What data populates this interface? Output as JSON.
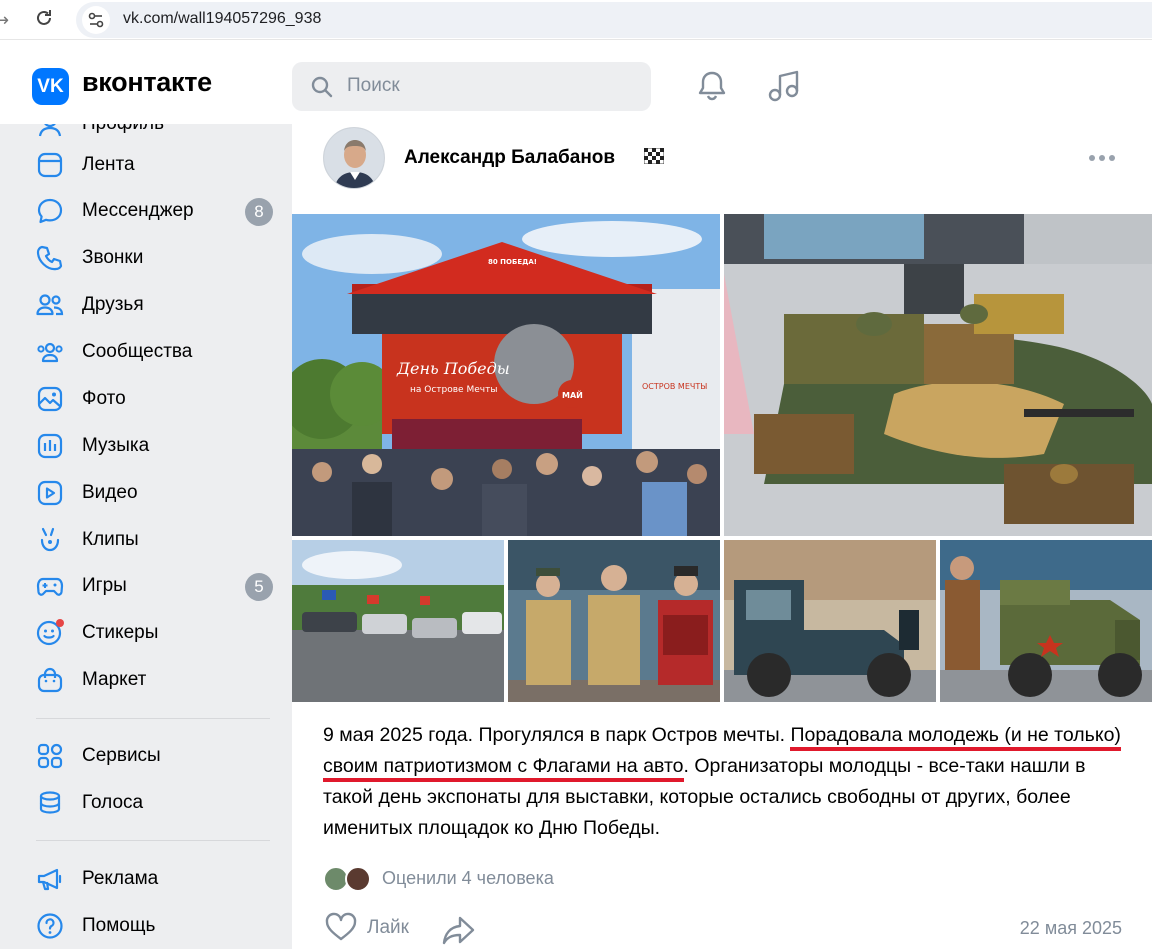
{
  "browser": {
    "url": "vk.com/wall194057296_938"
  },
  "header": {
    "logo_mark": "VK",
    "logo_text": "вконтакте",
    "search_placeholder": "Поиск",
    "icons": [
      "bell-icon",
      "music-icon"
    ]
  },
  "sidebar": {
    "items": [
      {
        "label": "Профиль",
        "icon": "user-icon"
      },
      {
        "label": "Лента",
        "icon": "feed-icon"
      },
      {
        "label": "Мессенджер",
        "icon": "chat-icon",
        "badge": "8"
      },
      {
        "label": "Звонки",
        "icon": "phone-icon"
      },
      {
        "label": "Друзья",
        "icon": "friends-icon"
      },
      {
        "label": "Сообщества",
        "icon": "groups-icon"
      },
      {
        "label": "Фото",
        "icon": "photo-icon"
      },
      {
        "label": "Музыка",
        "icon": "music-icon"
      },
      {
        "label": "Видео",
        "icon": "video-icon"
      },
      {
        "label": "Клипы",
        "icon": "clips-icon"
      },
      {
        "label": "Игры",
        "icon": "games-icon",
        "badge": "5"
      },
      {
        "label": "Стикеры",
        "icon": "stickers-icon"
      },
      {
        "label": "Маркет",
        "icon": "market-icon"
      }
    ],
    "items2": [
      {
        "label": "Сервисы",
        "icon": "services-icon"
      },
      {
        "label": "Голоса",
        "icon": "votes-icon"
      }
    ],
    "items3": [
      {
        "label": "Реклама",
        "icon": "ads-icon"
      },
      {
        "label": "Помощь",
        "icon": "help-icon"
      }
    ]
  },
  "post": {
    "author": "Александр Балабанов",
    "photos": [
      {
        "name": "stage-photo",
        "stage_title": "День Победы",
        "stage_subtitle": "на Острове Мечты",
        "badge_text": "80 ПОБЕДА!",
        "sign_text": "ОСТРОВ МЕЧТЫ",
        "stage_label": "МАЙ"
      },
      {
        "name": "military-exhibit-photo"
      },
      {
        "name": "parking-flags-photo"
      },
      {
        "name": "uniform-performers-photo"
      },
      {
        "name": "vintage-truck-photo"
      },
      {
        "name": "military-jeep-photo"
      }
    ],
    "text_before": "9 мая 2025 года. Прогулялся в парк Остров мечты. ",
    "text_highlight": "Порадовала молодежь (и не только) своим патриотизмом с Флагами на авто",
    "text_after": ". Организаторы молодцы - все-таки нашли в такой день экспонаты для выставки, которые остались свободны от других, более именитых площадок ко Дню Победы.",
    "liked_by": "Оценили 4 человека",
    "like_label": "Лайк",
    "date": "22 мая 2025"
  }
}
